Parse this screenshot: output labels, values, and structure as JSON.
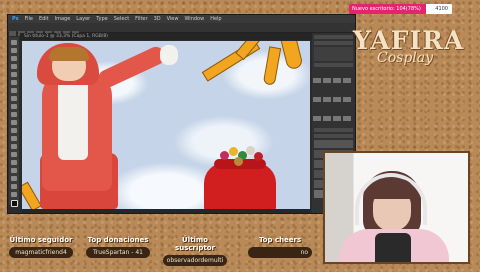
{
  "follower_goal": {
    "label": "Nuevo escritorio: 104(78%)",
    "goal": "4100",
    "progress_fraction": 0.75,
    "fill_color": "#e4246b"
  },
  "logo": {
    "main": "YAFIRA",
    "sub": "Cosplay"
  },
  "photoshop": {
    "menu": [
      "Ps",
      "File",
      "Edit",
      "Image",
      "Layer",
      "Type",
      "Select",
      "Filter",
      "3D",
      "View",
      "Window",
      "Help"
    ],
    "document_tab": "Sin título-1 @ 33,3% (Capa 1, RGB/8)"
  },
  "stats": {
    "last_follower": {
      "title": "Último seguidor",
      "value": "magmaticfriend4"
    },
    "top_donations": {
      "title": "Top donaciones",
      "value": "TrueSpartan - 41"
    },
    "last_subscriber": {
      "title": "Último suscriptor",
      "value": "observadordemulti"
    },
    "top_cheers": {
      "title": "Top cheers",
      "value": "no"
    }
  },
  "colors": {
    "cork": "#b98a57",
    "accent_pink": "#e4246b",
    "stat_box": "#3a2514"
  },
  "icons": [
    "ps-tool-icons",
    "webcam-feed"
  ]
}
